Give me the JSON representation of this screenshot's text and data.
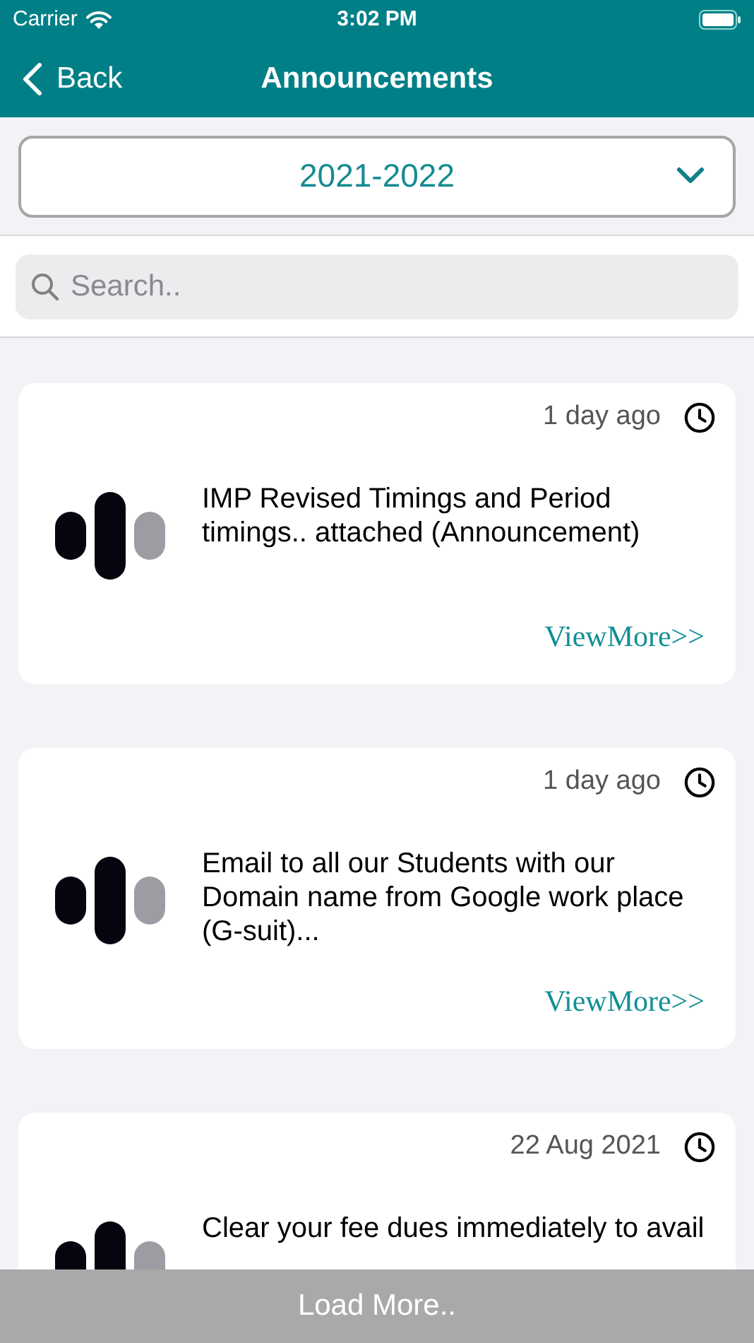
{
  "status_bar": {
    "carrier": "Carrier",
    "time": "3:02 PM"
  },
  "nav": {
    "back": "Back",
    "title": "Announcements"
  },
  "year_select": {
    "value": "2021-2022"
  },
  "search": {
    "placeholder": "Search.."
  },
  "announcements": [
    {
      "time": "1 day ago",
      "text": "IMP Revised Timings and Period timings.. attached (Announcement)",
      "link": "ViewMore>>"
    },
    {
      "time": "1 day ago",
      "text": "Email to all our Students with our Domain name from Google work place (G-suit)...",
      "link": "ViewMore>>"
    },
    {
      "time": "22 Aug 2021",
      "text": "Clear your fee dues immediately to avail"
    }
  ],
  "load_more": "Load More.."
}
